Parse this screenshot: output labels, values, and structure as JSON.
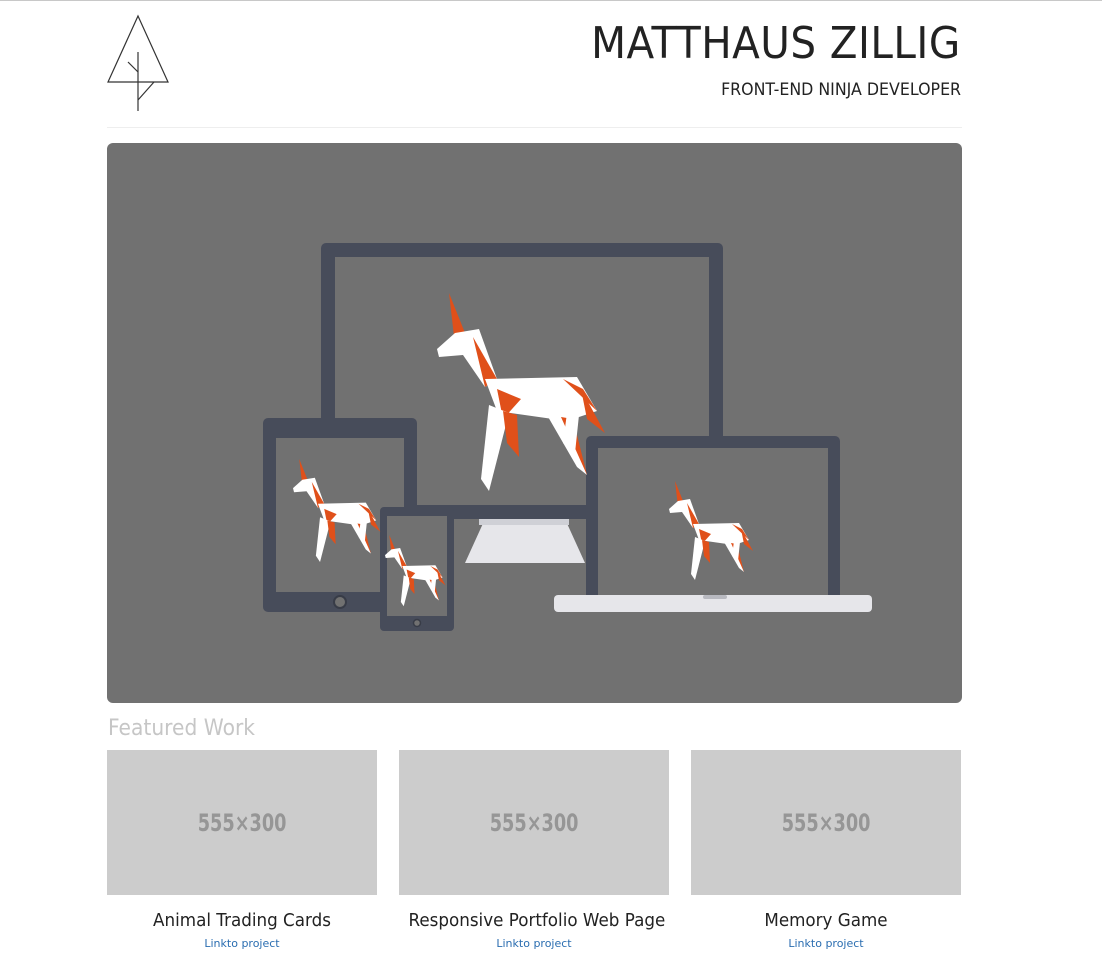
{
  "header": {
    "title": "MATTHAUS ZILLIG",
    "subtitle": "FRONT-END NINJA DEVELOPER",
    "logo_icon": "tree-logo-icon"
  },
  "hero": {
    "illustration": "devices-with-unicorns-illustration",
    "background": "#717171",
    "device_color": "#474c5a",
    "accent_orange": "#e0501a"
  },
  "featured": {
    "heading": "Featured Work",
    "projects": [
      {
        "thumbnail": "555×300",
        "title": "Animal Trading Cards",
        "link": "Linkto project"
      },
      {
        "thumbnail": "555×300",
        "title": "Responsive Portfolio Web Page",
        "link": "Linkto project"
      },
      {
        "thumbnail": "555×300",
        "title": "Memory Game",
        "link": "Linkto project"
      }
    ]
  }
}
